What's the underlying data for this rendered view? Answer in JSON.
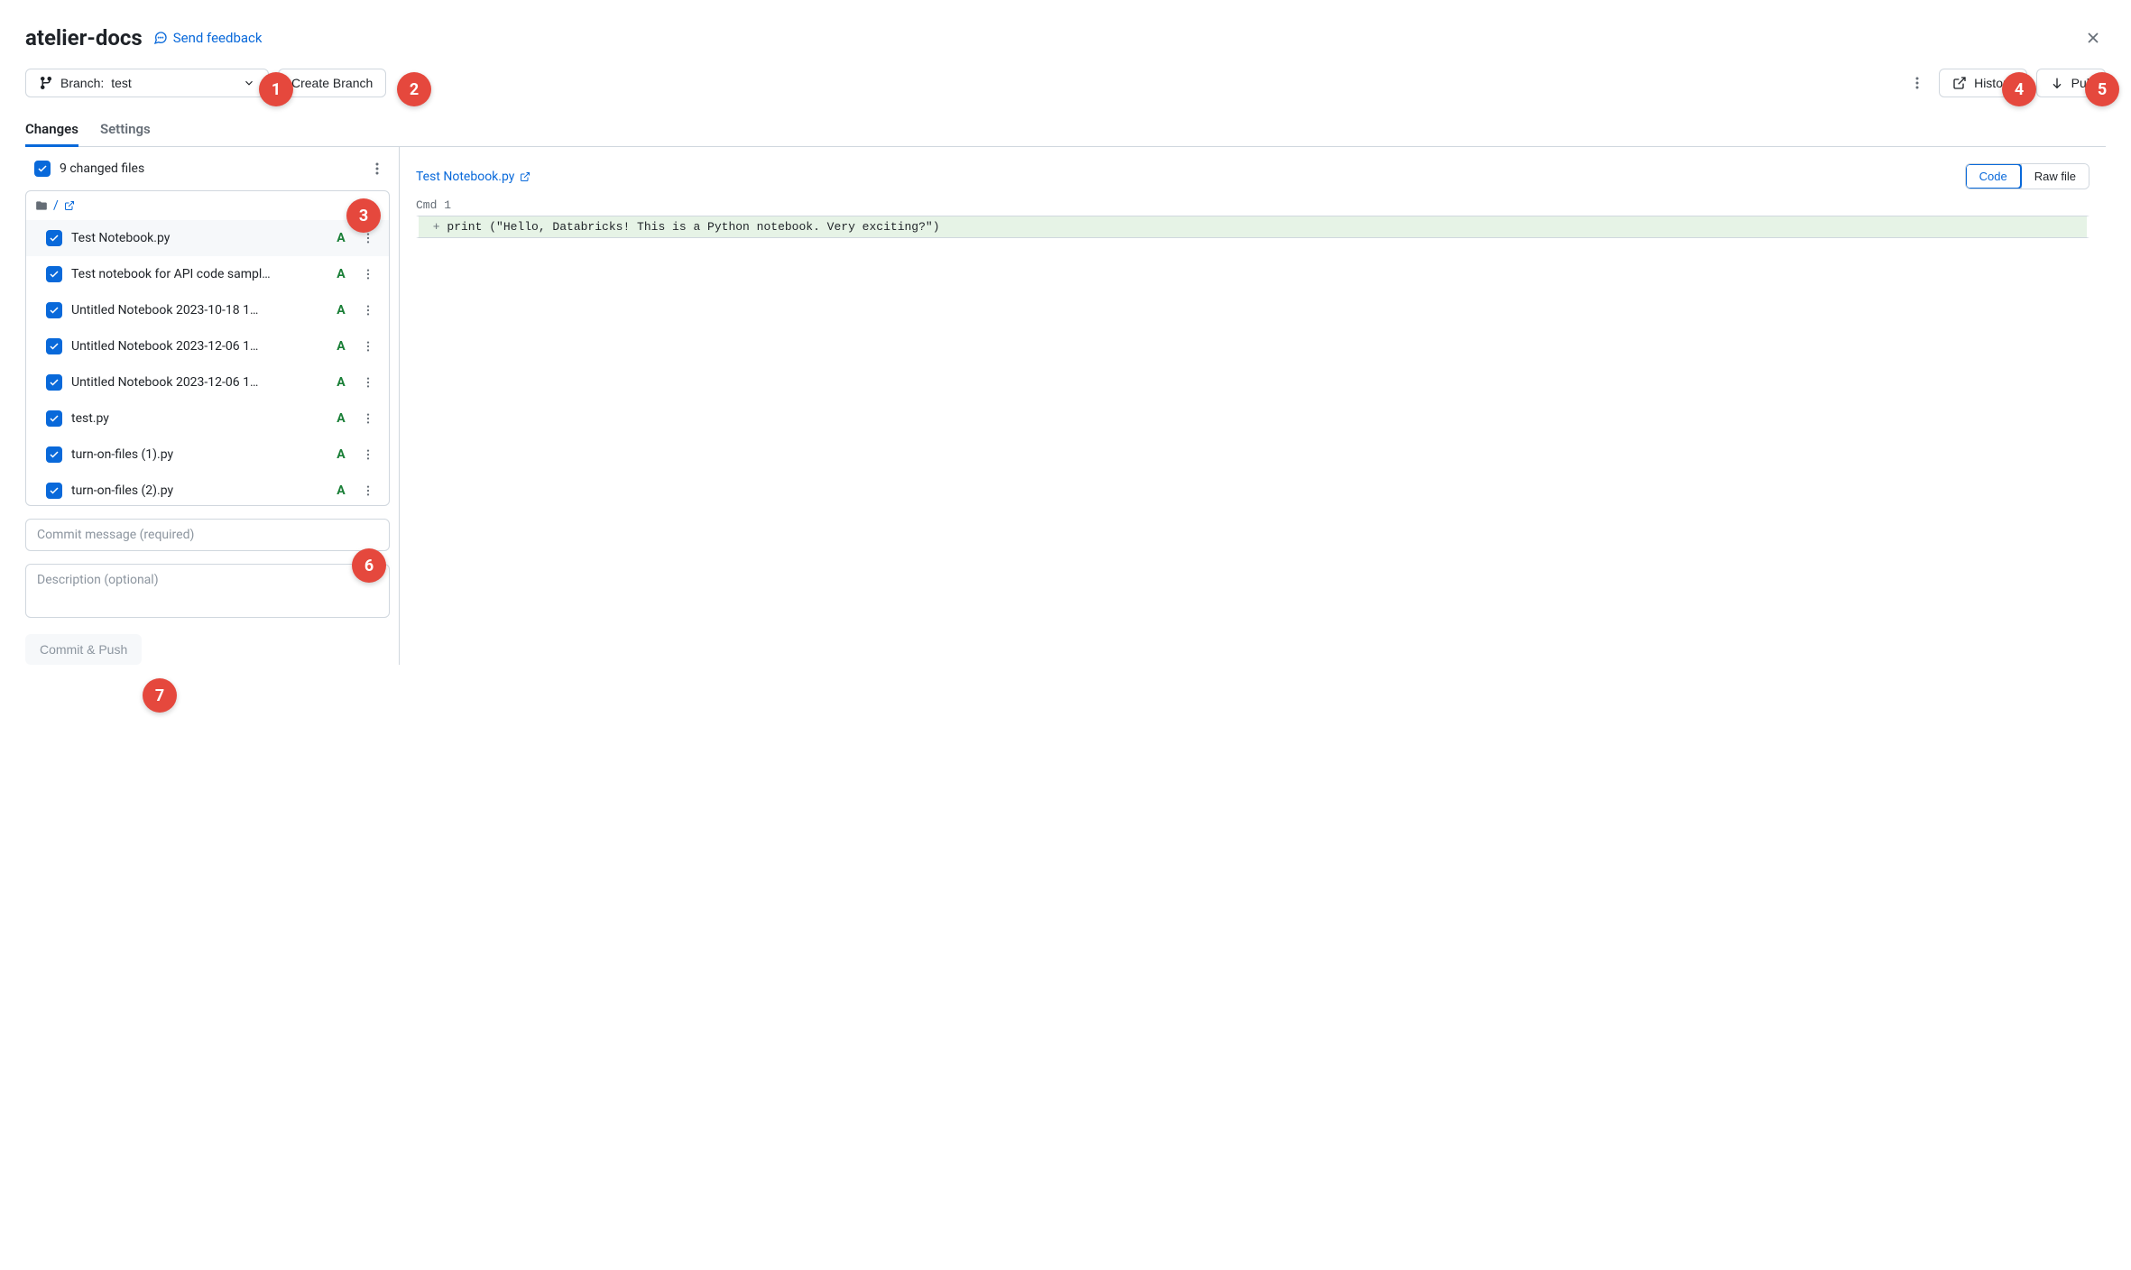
{
  "header": {
    "title": "atelier-docs",
    "feedback_label": "Send feedback"
  },
  "toolbar": {
    "branch_prefix": "Branch: ",
    "branch_name": "test",
    "create_branch_label": "Create Branch",
    "history_label": "History",
    "pull_label": "Pull"
  },
  "tabs": {
    "changes": "Changes",
    "settings": "Settings"
  },
  "changes": {
    "count_label": "9 changed files",
    "folder_path": "/",
    "files": [
      {
        "name": "Test Notebook.py",
        "status": "A",
        "selected": true
      },
      {
        "name": "Test notebook for API code sampl…",
        "status": "A",
        "selected": false
      },
      {
        "name": "Untitled Notebook 2023-10-18 1…",
        "status": "A",
        "selected": false
      },
      {
        "name": "Untitled Notebook 2023-12-06 1…",
        "status": "A",
        "selected": false
      },
      {
        "name": "Untitled Notebook 2023-12-06 1…",
        "status": "A",
        "selected": false
      },
      {
        "name": "test.py",
        "status": "A",
        "selected": false
      },
      {
        "name": "turn-on-files (1).py",
        "status": "A",
        "selected": false
      },
      {
        "name": "turn-on-files (2).py",
        "status": "A",
        "selected": false
      }
    ]
  },
  "commit": {
    "message_placeholder": "Commit message (required)",
    "description_placeholder": "Description (optional)",
    "button_label": "Commit & Push"
  },
  "diff": {
    "file_name": "Test Notebook.py",
    "toggle_code": "Code",
    "toggle_raw": "Raw file",
    "cmd_label": "Cmd 1",
    "line_prefix": " + ",
    "line_content": "print (\"Hello, Databricks! This is a Python notebook. Very exciting?\")"
  },
  "annotations": {
    "1": "1",
    "2": "2",
    "3": "3",
    "4": "4",
    "5": "5",
    "6": "6",
    "7": "7"
  }
}
